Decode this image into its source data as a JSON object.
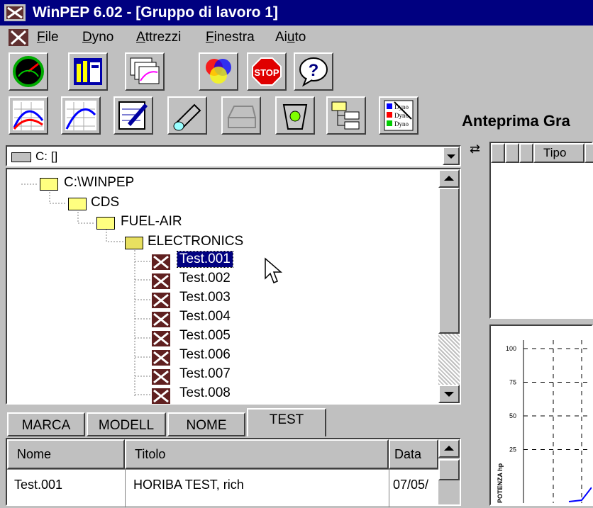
{
  "window": {
    "title": "WinPEP 6.02 - [Gruppo di lavoro 1]"
  },
  "menu": [
    {
      "label": "File",
      "mnemonic": "F"
    },
    {
      "label": "Dyno",
      "mnemonic": "D"
    },
    {
      "label": "Attrezzi",
      "mnemonic": "A"
    },
    {
      "label": "Finestra",
      "mnemonic": "F"
    },
    {
      "label": "Aiuto",
      "mnemonic": "u"
    }
  ],
  "toolbar1": [
    "gauge-icon",
    "bars-icon",
    "windows-icon",
    "color-wheel-icon",
    "stop-icon",
    "help-icon"
  ],
  "toolbar1_stop_text": "STOP",
  "toolbar1_help_text": "?",
  "toolbar2": [
    "curve-red-blue-icon",
    "curve-blue-icon",
    "edit-sheet-icon",
    "flashlight-icon",
    "printer-icon",
    "trash-icon",
    "tree-view-icon",
    "dyno-list-icon"
  ],
  "toolbar2_dyno_text": "Dyno",
  "preview_label": "Anteprima Gra",
  "drive": {
    "label": "C: []"
  },
  "tree": {
    "nodes": [
      "C:\\WINPEP",
      "CDS",
      "FUEL-AIR",
      "ELECTRONICS"
    ],
    "files": [
      "Test.001",
      "Test.002",
      "Test.003",
      "Test.004",
      "Test.005",
      "Test.006",
      "Test.007",
      "Test.008"
    ],
    "selected": "Test.001"
  },
  "tabs": [
    "MARCA",
    "MODELL",
    "NOME",
    "TEST"
  ],
  "active_tab": "TEST",
  "grid": {
    "columns": [
      "Nome",
      "Titolo",
      "Data"
    ],
    "rows": [
      [
        "Test.001",
        "HORIBA TEST, rich",
        "07/05/"
      ]
    ]
  },
  "right_panel": {
    "columns": [
      "Tipo"
    ]
  },
  "chart_data": {
    "type": "line",
    "ylabel": "POTENZA hp",
    "yticks": [
      100,
      75,
      50,
      25
    ],
    "series": []
  },
  "colors": {
    "titlebar": "#000080",
    "face": "#c0c0c0",
    "selection": "#000080"
  }
}
